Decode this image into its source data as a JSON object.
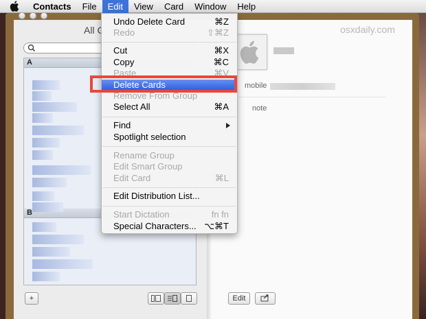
{
  "menubar": {
    "app": "Contacts",
    "items": [
      "File",
      "Edit",
      "View",
      "Card",
      "Window",
      "Help"
    ]
  },
  "window": {
    "title": "All C",
    "watermark": "osxdaily.com"
  },
  "list": {
    "section_a": "A",
    "section_b": "B"
  },
  "buttons": {
    "add": "+",
    "edit": "Edit"
  },
  "card": {
    "mobile_label": "mobile",
    "note_label": "note"
  },
  "edit_menu": {
    "undo": {
      "label": "Undo Delete Card",
      "shortcut": "⌘Z"
    },
    "redo": {
      "label": "Redo",
      "shortcut": "⇧⌘Z"
    },
    "cut": {
      "label": "Cut",
      "shortcut": "⌘X"
    },
    "copy": {
      "label": "Copy",
      "shortcut": "⌘C"
    },
    "paste": {
      "label": "Paste",
      "shortcut": "⌘V"
    },
    "delete_cards": {
      "label": "Delete Cards"
    },
    "remove_from_group": {
      "label": "Remove From Group"
    },
    "select_all": {
      "label": "Select All",
      "shortcut": "⌘A"
    },
    "find": {
      "label": "Find"
    },
    "spotlight": {
      "label": "Spotlight selection"
    },
    "rename_group": {
      "label": "Rename Group"
    },
    "edit_smart_group": {
      "label": "Edit Smart Group"
    },
    "edit_card": {
      "label": "Edit Card",
      "shortcut": "⌘L"
    },
    "edit_distribution": {
      "label": "Edit Distribution List..."
    },
    "start_dictation": {
      "label": "Start Dictation",
      "shortcut": "fn fn"
    },
    "special_characters": {
      "label": "Special Characters...",
      "shortcut": "⌥⌘T"
    }
  },
  "colors": {
    "menu_highlight": "#2a5ee2",
    "annotation_box": "#e8483c"
  }
}
